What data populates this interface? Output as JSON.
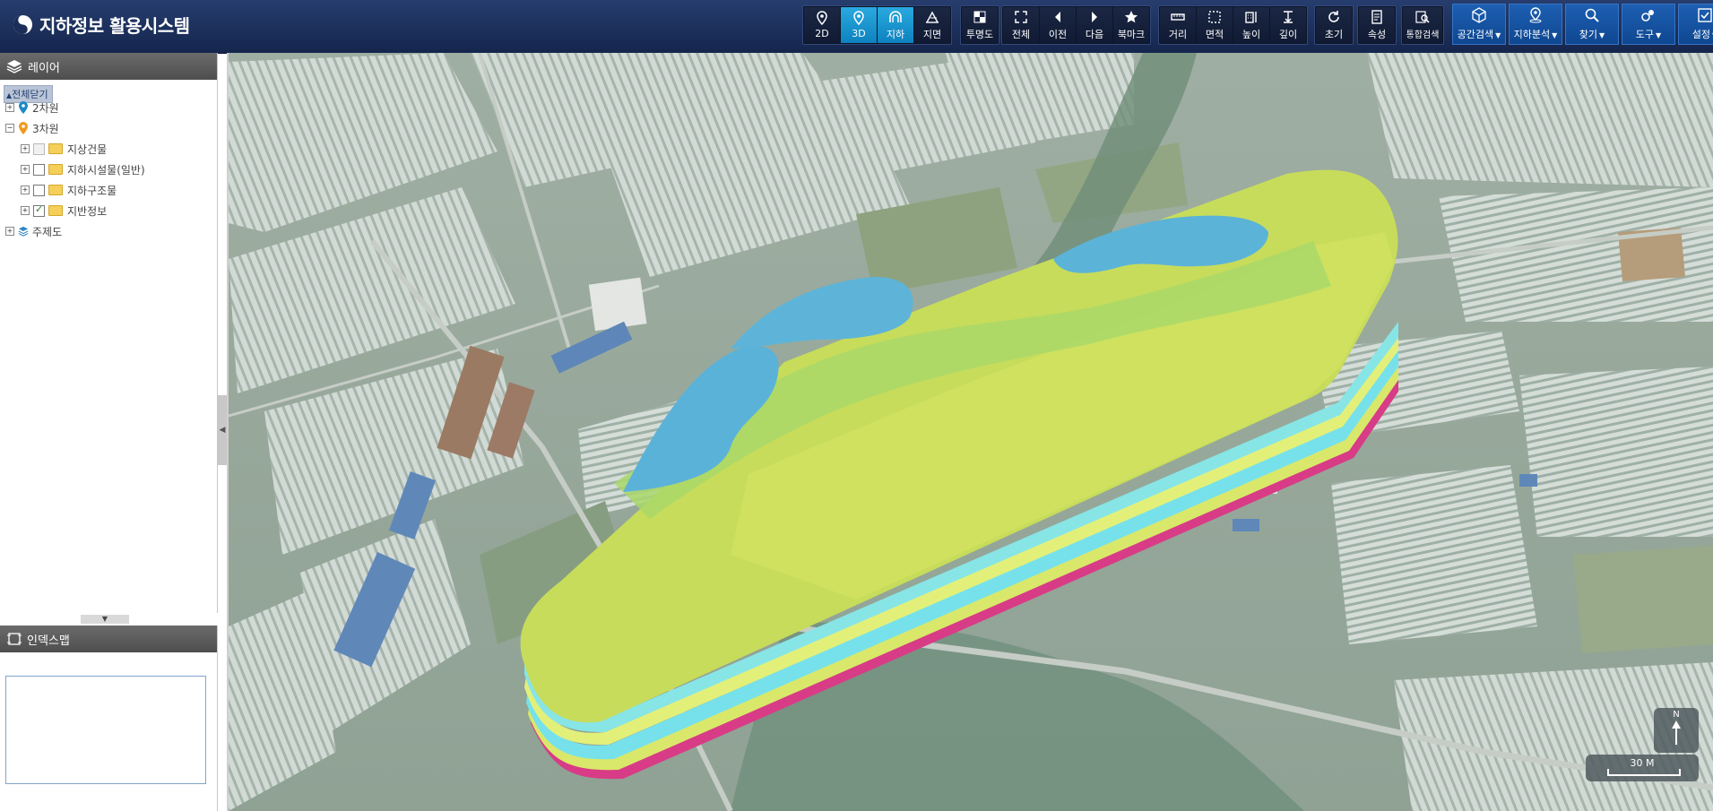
{
  "header": {
    "title": "지하정보 활용시스템",
    "view_modes": [
      {
        "label": "2D",
        "icon": "map-pin-2d-icon",
        "active": false
      },
      {
        "label": "3D",
        "icon": "map-pin-3d-icon",
        "active": true
      },
      {
        "label": "지하",
        "icon": "tunnel-icon",
        "active": true
      },
      {
        "label": "지면",
        "icon": "ground-icon",
        "active": false
      }
    ],
    "transparency_label": "투명도",
    "nav_buttons": [
      "전체",
      "이전",
      "다음",
      "북마크"
    ],
    "measure_buttons": [
      "거리",
      "면적",
      "높이",
      "깊이"
    ],
    "reset_label": "초기",
    "attribute_label": "속성",
    "integrated_search_label": "통합검색",
    "menus": [
      "공간검색",
      "지하분석",
      "찾기",
      "도구",
      "설정"
    ]
  },
  "layer_panel": {
    "title": "레이어",
    "close_all": "전체닫기",
    "tree": {
      "two_d": "2차원",
      "three_d": "3차원",
      "children": [
        {
          "label": "지상건물",
          "checked": false
        },
        {
          "label": "지하시설물(일반)",
          "checked": false
        },
        {
          "label": "지하구조물",
          "checked": false
        },
        {
          "label": "지반정보",
          "checked": true
        }
      ],
      "thematic": "주제도"
    }
  },
  "index_panel": {
    "title": "인덱스맵"
  },
  "map": {
    "north_label": "N",
    "scale_label": "30 M"
  },
  "colors": {
    "header_bg": "#1b2d58",
    "active_tool": "#16a0dc",
    "menu_blue": "#1656a6",
    "layer_top": "#c8df58",
    "water_pocket": "#5ab1d6",
    "layer_edge": "#d6226e"
  }
}
